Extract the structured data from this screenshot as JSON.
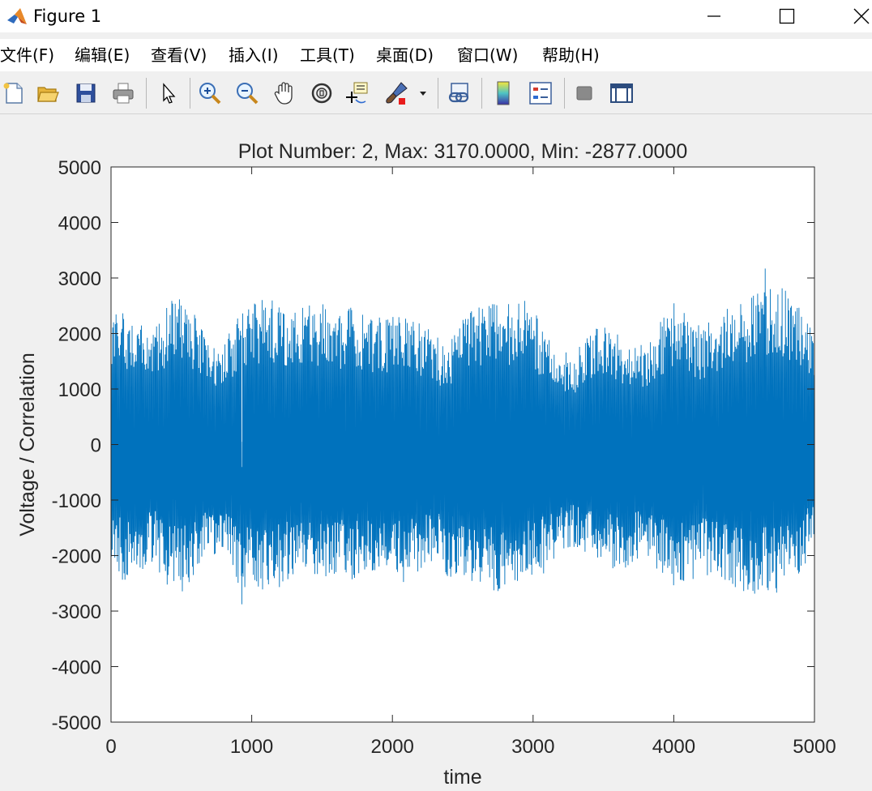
{
  "window": {
    "title": "Figure 1",
    "minimize_icon": "minimize-icon",
    "maximize_icon": "maximize-icon",
    "close_icon": "close-icon",
    "app_icon": "matlab-logo-icon"
  },
  "menu": {
    "items": [
      {
        "label": "文件(F)"
      },
      {
        "label": "编辑(E)"
      },
      {
        "label": "查看(V)"
      },
      {
        "label": "插入(I)"
      },
      {
        "label": "工具(T)"
      },
      {
        "label": "桌面(D)"
      },
      {
        "label": "窗口(W)"
      },
      {
        "label": "帮助(H)"
      }
    ]
  },
  "toolbar": {
    "icons": [
      "new-figure-icon",
      "open-file-icon",
      "save-icon",
      "print-icon",
      "pointer-icon",
      "zoom-in-icon",
      "zoom-out-icon",
      "pan-hand-icon",
      "rotate-3d-icon",
      "data-cursor-icon",
      "brush-icon",
      "brush-dropdown-icon",
      "link-plot-icon",
      "colorbar-icon",
      "legend-icon",
      "hide-plot-tools-icon",
      "show-plot-tools-icon"
    ]
  },
  "chart_data": {
    "type": "line",
    "title": "Plot Number: 2, Max: 3170.0000, Min: -2877.0000",
    "xlabel": "time",
    "ylabel": "Voltage / Correlation",
    "xlim": [
      0,
      5000
    ],
    "ylim": [
      -5000,
      5000
    ],
    "xticks": [
      "0",
      "1000",
      "2000",
      "3000",
      "4000",
      "5000"
    ],
    "yticks": [
      "5000",
      "4000",
      "3000",
      "2000",
      "1000",
      "0",
      "-1000",
      "-2000",
      "-3000",
      "-4000",
      "-5000"
    ],
    "grid": false,
    "legend": "none",
    "series": [
      {
        "color": "#0072bd",
        "n_points": 5000,
        "max": 3170,
        "min": -2877,
        "upper_envelope": {
          "x": [
            0,
            100,
            200,
            300,
            400,
            500,
            600,
            700,
            800,
            900,
            1000,
            1100,
            1200,
            1300,
            1400,
            1500,
            1600,
            1700,
            1800,
            1900,
            2000,
            2100,
            2200,
            2300,
            2400,
            2500,
            2600,
            2700,
            2800,
            2900,
            3000,
            3100,
            3200,
            3300,
            3400,
            3500,
            3600,
            3700,
            3800,
            3900,
            4000,
            4100,
            4200,
            4300,
            4400,
            4500,
            4600,
            4700,
            4800,
            4900,
            5000
          ],
          "y": [
            2300,
            2500,
            2200,
            2000,
            2600,
            2700,
            2400,
            1800,
            1900,
            2300,
            2600,
            2700,
            2600,
            2400,
            2500,
            2600,
            2300,
            2500,
            2400,
            2300,
            2400,
            2500,
            2200,
            2000,
            1800,
            2300,
            2500,
            2600,
            2500,
            2700,
            2500,
            2000,
            1700,
            1700,
            2000,
            2200,
            2000,
            1900,
            1800,
            2200,
            2600,
            2300,
            2100,
            2400,
            2500,
            2600,
            2800,
            2900,
            2800,
            2500,
            2200
          ]
        },
        "lower_envelope": {
          "x": [
            0,
            100,
            200,
            300,
            400,
            500,
            600,
            700,
            800,
            900,
            1000,
            1100,
            1200,
            1300,
            1400,
            1500,
            1600,
            1700,
            1800,
            1900,
            2000,
            2100,
            2200,
            2300,
            2400,
            2500,
            2600,
            2700,
            2800,
            2900,
            3000,
            3100,
            3200,
            3300,
            3400,
            3500,
            3600,
            3700,
            3800,
            3900,
            4000,
            4100,
            4200,
            4300,
            4400,
            4500,
            4600,
            4700,
            4800,
            4900,
            5000
          ],
          "y": [
            -2000,
            -2600,
            -2300,
            -2100,
            -2600,
            -2700,
            -2300,
            -2000,
            -2100,
            -2600,
            -2600,
            -2700,
            -2600,
            -2400,
            -2500,
            -2600,
            -2300,
            -2500,
            -2400,
            -2400,
            -2400,
            -2500,
            -2300,
            -2100,
            -2400,
            -2500,
            -2600,
            -2700,
            -2600,
            -2600,
            -2400,
            -2300,
            -2000,
            -1900,
            -2000,
            -2100,
            -2300,
            -2200,
            -2000,
            -2300,
            -2600,
            -2500,
            -2300,
            -2500,
            -2600,
            -2700,
            -2700,
            -2700,
            -2600,
            -2400,
            -1800
          ]
        }
      }
    ]
  }
}
